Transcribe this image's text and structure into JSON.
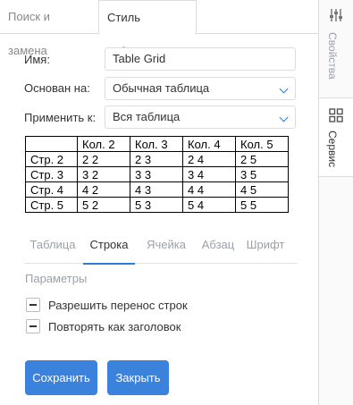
{
  "tabs": [
    {
      "label": "Поиск и замена",
      "active": false
    },
    {
      "label": "Стиль таблицы",
      "active": true
    }
  ],
  "form": {
    "name_label": "Имя:",
    "name_value": "Table Grid",
    "based_on_label": "Основан на:",
    "based_on_value": "Обычная таблица",
    "apply_to_label": "Применить к:",
    "apply_to_value": "Вся таблица"
  },
  "preview_table": {
    "header": [
      "",
      "Кол. 2",
      "Кол. 3",
      "Кол. 4",
      "Кол. 5"
    ],
    "rows": [
      [
        "Стр. 2",
        "2 2",
        "2 3",
        "2 4",
        "2 5"
      ],
      [
        "Стр. 3",
        "3 2",
        "3 3",
        "3 4",
        "3 5"
      ],
      [
        "Стр. 4",
        "4 2",
        "4 3",
        "4 4",
        "4 5"
      ],
      [
        "Стр. 5",
        "5 2",
        "5 3",
        "5 4",
        "5 5"
      ]
    ]
  },
  "subtabs": [
    {
      "label": "Таблица",
      "active": false
    },
    {
      "label": "Строка",
      "active": true
    },
    {
      "label": "Ячейка",
      "active": false
    },
    {
      "label": "Абзац",
      "active": false
    },
    {
      "label": "Шрифт",
      "active": false
    }
  ],
  "params": {
    "title": "Параметры",
    "options": [
      {
        "label": "Разрешить перенос строк",
        "state": "indeterminate"
      },
      {
        "label": "Повторять как заголовок",
        "state": "indeterminate"
      }
    ]
  },
  "buttons": {
    "save": "Сохранить",
    "close": "Закрыть"
  },
  "sidebar": [
    {
      "label": "Свойства",
      "icon": "sliders-icon",
      "active": false
    },
    {
      "label": "Сервис",
      "icon": "grid-icon",
      "active": true
    }
  ],
  "colors": {
    "accent": "#3b82dd",
    "active_tab_underline": "#2f7bd9",
    "muted_text": "#9aa1ab"
  }
}
